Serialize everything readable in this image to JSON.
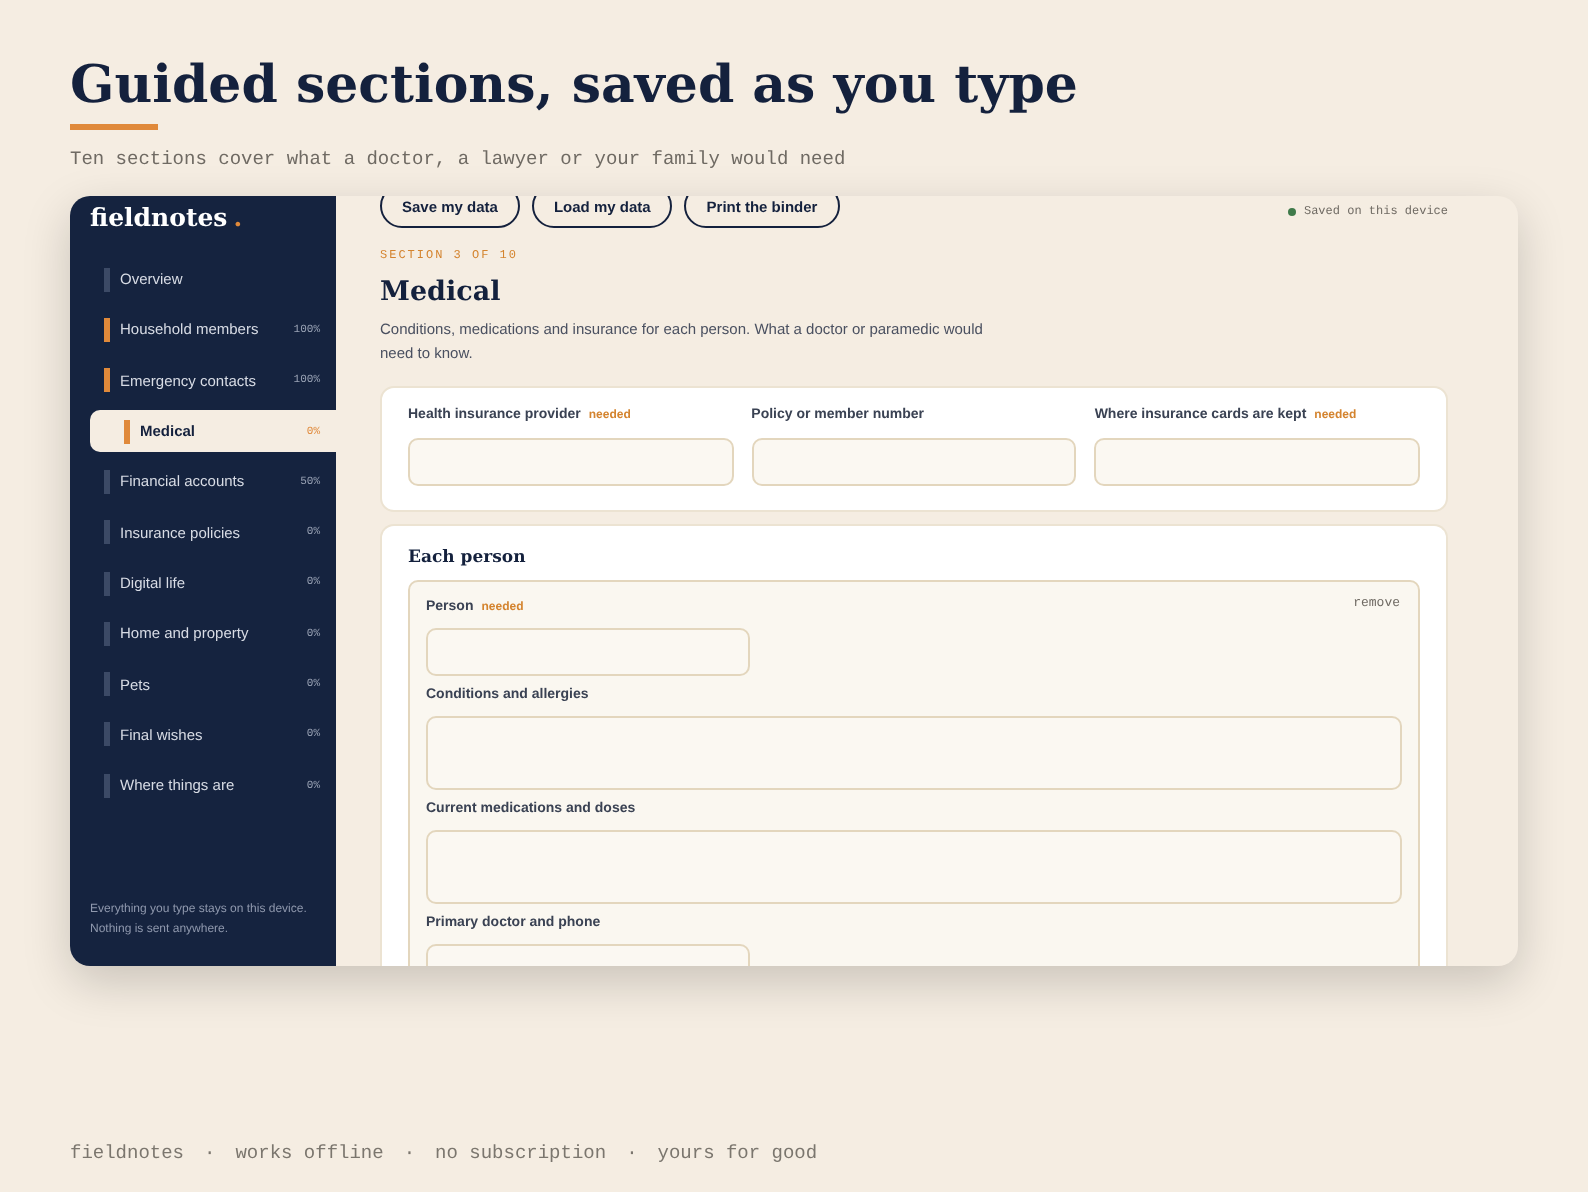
{
  "heading": {
    "title": "Guided sections, saved as you type",
    "subtitle": "Ten sections cover what a doctor, a lawyer or your family would need"
  },
  "sidebar": {
    "logo": "fieldnotes",
    "logo_dot": ".",
    "items": [
      {
        "label": "Overview",
        "selected": false,
        "complete": false
      },
      {
        "label": "Household members",
        "percent": "100%",
        "selected": false,
        "complete": true
      },
      {
        "label": "Emergency contacts",
        "percent": "100%",
        "selected": false,
        "complete": true
      },
      {
        "label": "Medical",
        "percent": "0%",
        "selected": true,
        "complete": false
      },
      {
        "label": "Financial accounts",
        "percent": "50%",
        "selected": false,
        "complete": false
      },
      {
        "label": "Insurance policies",
        "percent": "0%",
        "selected": false,
        "complete": false
      },
      {
        "label": "Digital life",
        "percent": "0%",
        "selected": false,
        "complete": false
      },
      {
        "label": "Home and property",
        "percent": "0%",
        "selected": false,
        "complete": false
      },
      {
        "label": "Pets",
        "percent": "0%",
        "selected": false,
        "complete": false
      },
      {
        "label": "Final wishes",
        "percent": "0%",
        "selected": false,
        "complete": false
      },
      {
        "label": "Where things are",
        "percent": "0%",
        "selected": false,
        "complete": false
      }
    ],
    "footer_note": "Everything you type stays on this device. Nothing is sent anywhere."
  },
  "toolbar": {
    "buttons": [
      "Save my data",
      "Load my data",
      "Print the binder"
    ],
    "status": "Saved on this device"
  },
  "section": {
    "eyebrow": "SECTION 3 OF 10",
    "title": "Medical",
    "description": "Conditions, medications and insurance for each person. What a doctor or paramedic would need to know.",
    "insurance_fields": [
      {
        "label": "Health insurance provider",
        "tag": "needed"
      },
      {
        "label": "Policy or member number"
      },
      {
        "label": "Where insurance cards are kept",
        "tag": "needed"
      }
    ],
    "person_card": {
      "title": "Each person",
      "remove": "remove",
      "fields": [
        {
          "label": "Person",
          "tag": "needed",
          "kind": "short"
        },
        {
          "label": "Conditions and allergies",
          "kind": "long"
        },
        {
          "label": "Current medications and doses",
          "kind": "long"
        },
        {
          "label": "Primary doctor and phone",
          "kind": "short"
        }
      ]
    }
  },
  "footer": {
    "items": [
      "fieldnotes",
      "works offline",
      "no subscription",
      "yours for good"
    ],
    "separator": "·"
  }
}
